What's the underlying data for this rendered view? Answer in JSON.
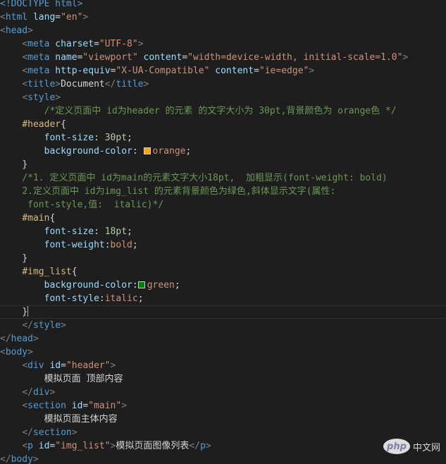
{
  "editor": {
    "theme": "dark",
    "background": "#1e1e1e",
    "lines": [
      [
        [
          "tag",
          "<!DOCTYPE html>"
        ]
      ],
      [
        [
          "br",
          "<"
        ],
        [
          "tag",
          "html"
        ],
        [
          "text",
          " "
        ],
        [
          "attr",
          "lang"
        ],
        [
          "pun",
          "="
        ],
        [
          "str",
          "\"en\""
        ],
        [
          "br",
          ">"
        ]
      ],
      [
        [
          "br",
          "<"
        ],
        [
          "tag",
          "head"
        ],
        [
          "br",
          ">"
        ]
      ],
      [
        [
          "text",
          "    "
        ],
        [
          "br",
          "<"
        ],
        [
          "tag",
          "meta"
        ],
        [
          "text",
          " "
        ],
        [
          "attr",
          "charset"
        ],
        [
          "pun",
          "="
        ],
        [
          "str",
          "\"UTF-8\""
        ],
        [
          "br",
          ">"
        ]
      ],
      [
        [
          "text",
          "    "
        ],
        [
          "br",
          "<"
        ],
        [
          "tag",
          "meta"
        ],
        [
          "text",
          " "
        ],
        [
          "attr",
          "name"
        ],
        [
          "pun",
          "="
        ],
        [
          "str",
          "\"viewport\""
        ],
        [
          "text",
          " "
        ],
        [
          "attr",
          "content"
        ],
        [
          "pun",
          "="
        ],
        [
          "str",
          "\"width=device-width, initial-scale=1.0\""
        ],
        [
          "br",
          ">"
        ]
      ],
      [
        [
          "text",
          "    "
        ],
        [
          "br",
          "<"
        ],
        [
          "tag",
          "meta"
        ],
        [
          "text",
          " "
        ],
        [
          "attr",
          "http-equiv"
        ],
        [
          "pun",
          "="
        ],
        [
          "str",
          "\"X-UA-Compatible\""
        ],
        [
          "text",
          " "
        ],
        [
          "attr",
          "content"
        ],
        [
          "pun",
          "="
        ],
        [
          "str",
          "\"ie=edge\""
        ],
        [
          "br",
          ">"
        ]
      ],
      [
        [
          "text",
          "    "
        ],
        [
          "br",
          "<"
        ],
        [
          "tag",
          "title"
        ],
        [
          "br",
          ">"
        ],
        [
          "text",
          "Document"
        ],
        [
          "br",
          "</"
        ],
        [
          "tag",
          "title"
        ],
        [
          "br",
          ">"
        ]
      ],
      [
        [
          "text",
          "    "
        ],
        [
          "br",
          "<"
        ],
        [
          "tag",
          "style"
        ],
        [
          "br",
          ">"
        ]
      ],
      [
        [
          "text",
          "        "
        ],
        [
          "com",
          "/*定义页面中 id为header 的元素 的文字大小为 30pt,背景颜色为 orange色 */"
        ]
      ],
      [
        [
          "text",
          "    "
        ],
        [
          "sel",
          "#header"
        ],
        [
          "pun",
          "{"
        ]
      ],
      [
        [
          "text",
          "        "
        ],
        [
          "prop",
          "font-size"
        ],
        [
          "pun",
          ": "
        ],
        [
          "num",
          "30pt"
        ],
        [
          "pun",
          ";"
        ]
      ],
      [
        [
          "text",
          "        "
        ],
        [
          "prop",
          "background-color"
        ],
        [
          "pun",
          ": "
        ],
        [
          "swatch",
          "#ffa500"
        ],
        [
          "val",
          "orange"
        ],
        [
          "pun",
          ";"
        ]
      ],
      [
        [
          "text",
          "    "
        ],
        [
          "pun",
          "}"
        ]
      ],
      [
        [
          "text",
          "    "
        ],
        [
          "com",
          "/*1. 定义页面中 id为main的元素文字大小18pt,  加粗显示(font-weight: bold)"
        ]
      ],
      [
        [
          "text",
          "    "
        ],
        [
          "com",
          "2.定义页面中 id为img_list 的元素背景颜色为绿色,斜体显示文字(属性:"
        ]
      ],
      [
        [
          "text",
          "     "
        ],
        [
          "com",
          "font-style,值:  italic)*/"
        ]
      ],
      [
        [
          "text",
          "    "
        ],
        [
          "sel",
          "#main"
        ],
        [
          "pun",
          "{"
        ]
      ],
      [
        [
          "text",
          "        "
        ],
        [
          "prop",
          "font-size"
        ],
        [
          "pun",
          ": "
        ],
        [
          "num",
          "18pt"
        ],
        [
          "pun",
          ";"
        ]
      ],
      [
        [
          "text",
          "        "
        ],
        [
          "prop",
          "font-weight"
        ],
        [
          "pun",
          ":"
        ],
        [
          "val",
          "bold"
        ],
        [
          "pun",
          ";"
        ]
      ],
      [
        [
          "text",
          "    "
        ],
        [
          "pun",
          "}"
        ]
      ],
      [
        [
          "text",
          "    "
        ],
        [
          "sel",
          "#img_list"
        ],
        [
          "pun",
          "{"
        ]
      ],
      [
        [
          "text",
          "        "
        ],
        [
          "prop",
          "background-color"
        ],
        [
          "pun",
          ":"
        ],
        [
          "swatch",
          "#008000"
        ],
        [
          "val",
          "green"
        ],
        [
          "pun",
          ";"
        ]
      ],
      [
        [
          "text",
          "        "
        ],
        [
          "prop",
          "font-style"
        ],
        [
          "pun",
          ":"
        ],
        [
          "val",
          "italic"
        ],
        [
          "pun",
          ";"
        ]
      ],
      [
        [
          "text",
          "    "
        ],
        [
          "pun",
          "}"
        ],
        [
          "cursor",
          ""
        ]
      ],
      [
        [
          "text",
          "    "
        ],
        [
          "br",
          "</"
        ],
        [
          "tag",
          "style"
        ],
        [
          "br",
          ">"
        ]
      ],
      [
        [
          "br",
          "</"
        ],
        [
          "tag",
          "head"
        ],
        [
          "br",
          ">"
        ]
      ],
      [
        [
          "br",
          "<"
        ],
        [
          "tag",
          "body"
        ],
        [
          "br",
          ">"
        ]
      ],
      [
        [
          "text",
          "    "
        ],
        [
          "br",
          "<"
        ],
        [
          "tag",
          "div"
        ],
        [
          "text",
          " "
        ],
        [
          "attr",
          "id"
        ],
        [
          "pun",
          "="
        ],
        [
          "str",
          "\"header\""
        ],
        [
          "br",
          ">"
        ]
      ],
      [
        [
          "text",
          "        模拟页面 顶部内容"
        ]
      ],
      [
        [
          "text",
          "    "
        ],
        [
          "br",
          "</"
        ],
        [
          "tag",
          "div"
        ],
        [
          "br",
          ">"
        ]
      ],
      [
        [
          "text",
          "    "
        ],
        [
          "br",
          "<"
        ],
        [
          "tag",
          "section"
        ],
        [
          "text",
          " "
        ],
        [
          "attr",
          "id"
        ],
        [
          "pun",
          "="
        ],
        [
          "str",
          "\"main\""
        ],
        [
          "br",
          ">"
        ]
      ],
      [
        [
          "text",
          "        模拟页面主体内容"
        ]
      ],
      [
        [
          "text",
          "    "
        ],
        [
          "br",
          "</"
        ],
        [
          "tag",
          "section"
        ],
        [
          "br",
          ">"
        ]
      ],
      [
        [
          "text",
          "    "
        ],
        [
          "br",
          "<"
        ],
        [
          "tag",
          "p"
        ],
        [
          "text",
          " "
        ],
        [
          "attr",
          "id"
        ],
        [
          "pun",
          "="
        ],
        [
          "str",
          "\"img_list\""
        ],
        [
          "br",
          ">"
        ],
        [
          "text",
          "模拟页面图像列表"
        ],
        [
          "br",
          "</"
        ],
        [
          "tag",
          "p"
        ],
        [
          "br",
          ">"
        ]
      ],
      [
        [
          "br",
          "</"
        ],
        [
          "tag",
          "body"
        ],
        [
          "br",
          ">"
        ]
      ]
    ]
  },
  "watermark": {
    "logo": "php",
    "text": "中文网"
  }
}
